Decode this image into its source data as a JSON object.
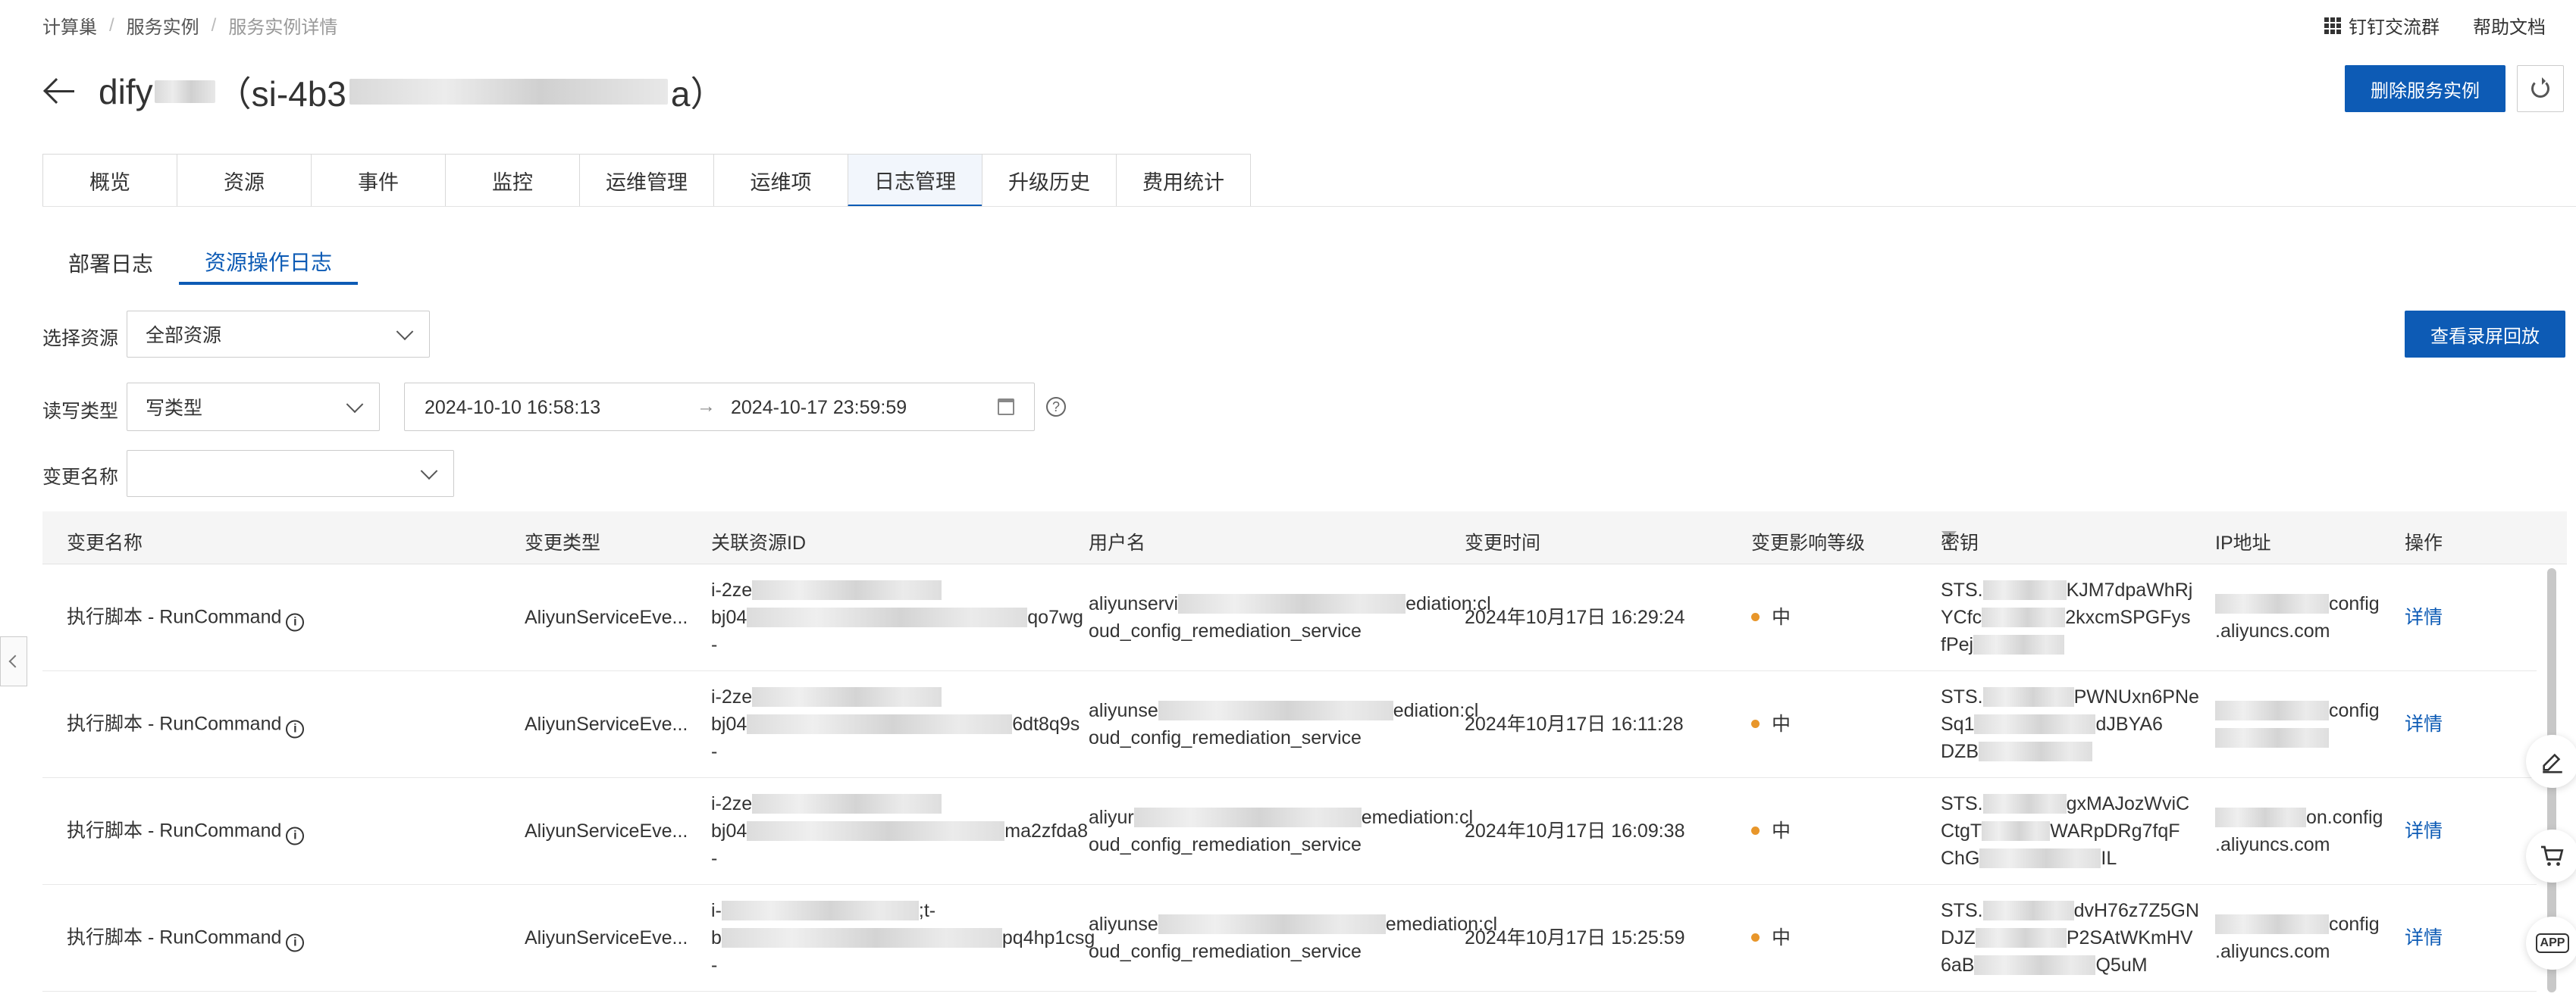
{
  "breadcrumb": {
    "items": [
      "计算巢",
      "服务实例"
    ],
    "current": "服务实例详情"
  },
  "top_links": {
    "dingtalk": "钉钉交流群",
    "help": "帮助文档"
  },
  "title": {
    "prefix": "dify",
    "paren_open": "（si-4b3",
    "suffix": "a）"
  },
  "buttons": {
    "delete": "删除服务实例",
    "replay": "查看录屏回放"
  },
  "tabs": [
    "概览",
    "资源",
    "事件",
    "监控",
    "运维管理",
    "运维项",
    "日志管理",
    "升级历史",
    "费用统计"
  ],
  "active_tab": "日志管理",
  "subtabs": [
    "部署日志",
    "资源操作日志"
  ],
  "active_subtab": "资源操作日志",
  "filters": {
    "resource_label": "选择资源",
    "resource_value": "全部资源",
    "rw_label": "读写类型",
    "rw_value": "写类型",
    "date_start": "2024-10-10 16:58:13",
    "date_arrow": "→",
    "date_end": "2024-10-17 23:59:59",
    "change_label": "变更名称",
    "change_value": ""
  },
  "table": {
    "columns": [
      "变更名称",
      "变更类型",
      "关联资源ID",
      "用户名",
      "变更时间",
      "变更影响等级",
      "密钥",
      "IP地址",
      "操作"
    ],
    "rows": [
      {
        "name": "执行脚本 - RunCommand",
        "type": "AliyunServiceEve...",
        "res1": "i-2ze",
        "res2a": "bj04",
        "res2b": "qo7wg",
        "res3": "-",
        "user1a": "aliyunservi",
        "user1b": "ediation:cl",
        "user2": "oud_config_remediation_service",
        "time": "2024年10月17日 16:29:24",
        "level": "中",
        "key1a": "STS.",
        "key1b": "KJM7dpaWhRj",
        "key2a": "YCfc",
        "key2b": "2kxcmSPGFys",
        "key3a": "fPej",
        "key3b": "",
        "ip1b": "config",
        "ip2": ".aliyuncs.com",
        "action": "详情"
      },
      {
        "name": "执行脚本 - RunCommand",
        "type": "AliyunServiceEve...",
        "res1": "i-2ze",
        "res2a": "bj04",
        "res2b": "6dt8q9s",
        "res3": "-",
        "user1a": "aliyunse",
        "user1b": "ediation:cl",
        "user2": "oud_config_remediation_service",
        "time": "2024年10月17日 16:11:28",
        "level": "中",
        "key1a": "STS.",
        "key1b": "PWNUxn6PNe",
        "key2a": "Sq1",
        "key2b": "dJBYA6",
        "key3a": "DZB",
        "key3b": "",
        "ip1b": "config",
        "ip2": "",
        "action": "详情"
      },
      {
        "name": "执行脚本 - RunCommand",
        "type": "AliyunServiceEve...",
        "res1": "i-2ze",
        "res2a": "bj04",
        "res2b": "ma2zfda8",
        "res3": "-",
        "user1a": "aliyur",
        "user1b": "emediation:cl",
        "user2": "oud_config_remediation_service",
        "time": "2024年10月17日 16:09:38",
        "level": "中",
        "key1a": "STS.",
        "key1b": "gxMAJozWviC",
        "key2a": "CtgT",
        "key2b": "WARpDRg7fqF",
        "key3a": "ChG",
        "key3b": "IL",
        "ip1b": "on.config",
        "ip2": ".aliyuncs.com",
        "action": "详情"
      },
      {
        "name": "执行脚本 - RunCommand",
        "type": "AliyunServiceEve...",
        "res1": "i-",
        "res1b": ";t-",
        "res2a": "b",
        "res2b": "pq4hp1csg",
        "res3": "-",
        "user1a": "aliyunse",
        "user1b": "emediation:cl",
        "user2": "oud_config_remediation_service",
        "time": "2024年10月17日 15:25:59",
        "level": "中",
        "key1a": "STS.",
        "key1b": "dvH76z7Z5GN",
        "key2a": "DJZ",
        "key2b": "P2SAtWKmHV",
        "key3a": "6aB",
        "key3b": "Q5uM",
        "ip1b": "config",
        "ip2": ".aliyuncs.com",
        "action": "详情"
      }
    ]
  },
  "float_buttons": [
    "edit-icon",
    "cart-icon",
    "app-icon"
  ],
  "float_app_label": "APP"
}
